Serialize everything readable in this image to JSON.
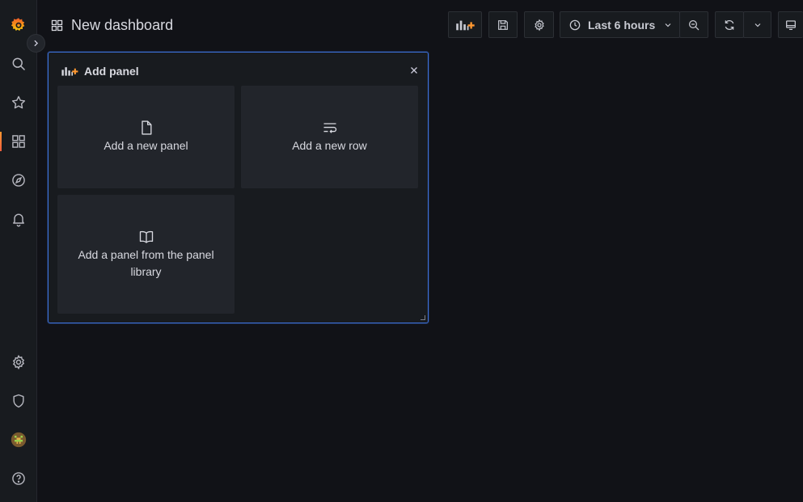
{
  "dashboard": {
    "title": "New dashboard"
  },
  "toolbar": {
    "add_panel_icon": "add-panel-icon",
    "save_icon": "save-icon",
    "settings_icon": "gear-icon",
    "time_range_label": "Last 6 hours",
    "zoom_out_icon": "zoom-out-icon",
    "refresh_icon": "refresh-icon",
    "tv_mode_icon": "monitor-icon"
  },
  "sidebar": {
    "items": [
      {
        "name": "grafana-logo",
        "interactable": true
      },
      {
        "name": "search-icon",
        "interactable": true
      },
      {
        "name": "star-icon",
        "interactable": true
      },
      {
        "name": "dashboards-icon",
        "interactable": true,
        "active": true
      },
      {
        "name": "explore-icon",
        "interactable": true
      },
      {
        "name": "alerting-bell-icon",
        "interactable": true
      },
      {
        "name": "configuration-gear-icon",
        "interactable": true
      },
      {
        "name": "server-admin-shield-icon",
        "interactable": true
      },
      {
        "name": "user-avatar",
        "interactable": true
      },
      {
        "name": "help-icon",
        "interactable": true
      }
    ]
  },
  "add_panel": {
    "header": "Add panel",
    "cards": {
      "new_panel": "Add a new panel",
      "new_row": "Add a new row",
      "from_library": "Add a panel from the panel library"
    }
  },
  "colors": {
    "background": "#111217",
    "sidebar": "#181b1f",
    "panel_border": "#3d71d9",
    "card": "#22252b",
    "accent_orange": "#ff9830"
  }
}
